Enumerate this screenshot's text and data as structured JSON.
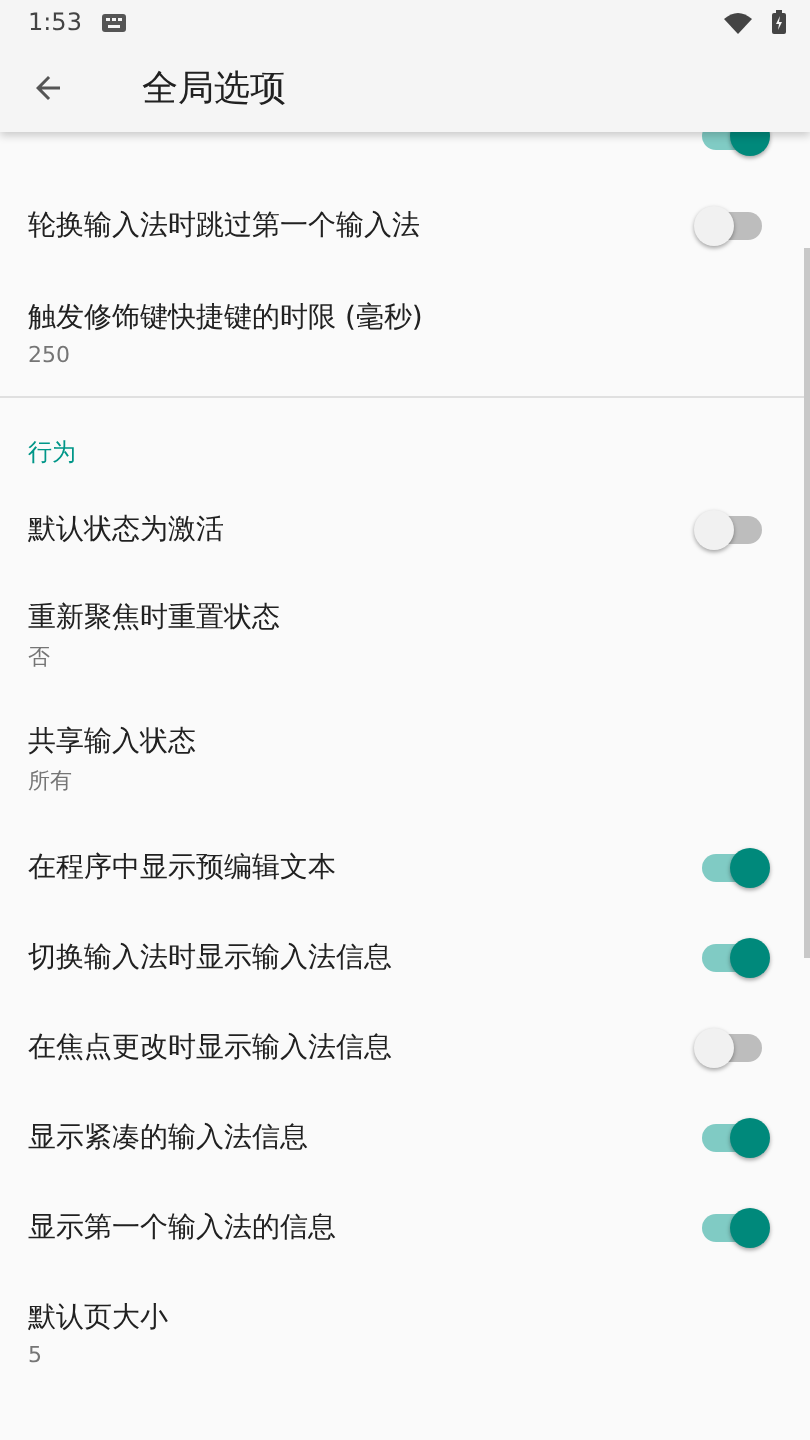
{
  "status_bar": {
    "time": "1:53"
  },
  "toolbar": {
    "title": "全局选项"
  },
  "sections": [
    {
      "items": [
        {
          "kind": "switch",
          "on": true
        },
        {
          "kind": "switch",
          "title": "轮换输入法时跳过第一个输入法",
          "on": false
        },
        {
          "kind": "text",
          "title": "触发修饰键快捷键的时限 (毫秒)",
          "summary": "250"
        }
      ]
    },
    {
      "header": "行为",
      "items": [
        {
          "kind": "switch",
          "title": "默认状态为激活",
          "on": false
        },
        {
          "kind": "text",
          "title": "重新聚焦时重置状态",
          "summary": "否"
        },
        {
          "kind": "text",
          "title": "共享输入状态",
          "summary": "所有"
        },
        {
          "kind": "switch",
          "title": "在程序中显示预编辑文本",
          "on": true
        },
        {
          "kind": "switch",
          "title": "切换输入法时显示输入法信息",
          "on": true
        },
        {
          "kind": "switch",
          "title": "在焦点更改时显示输入法信息",
          "on": false
        },
        {
          "kind": "switch",
          "title": "显示紧凑的输入法信息",
          "on": true
        },
        {
          "kind": "switch",
          "title": "显示第一个输入法的信息",
          "on": true
        },
        {
          "kind": "text",
          "title": "默认页大小",
          "summary": "5"
        }
      ]
    }
  ]
}
